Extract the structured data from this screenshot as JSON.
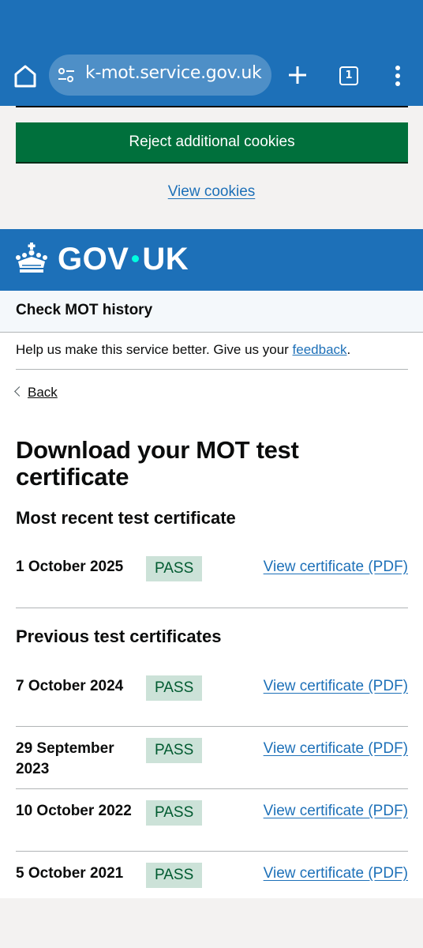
{
  "browser": {
    "url": "k-mot.service.gov.uk",
    "tab_count": "1"
  },
  "cookies": {
    "reject_label": "Reject additional cookies",
    "view_label": "View cookies"
  },
  "header": {
    "logo_left": "GOV",
    "logo_right": "UK",
    "service_name": "Check MOT history"
  },
  "feedback": {
    "prefix": "Help us make this service better. Give us your ",
    "link": "feedback",
    "suffix": "."
  },
  "back_label": "Back",
  "page_title": "Download your MOT test certificate",
  "most_recent": {
    "heading": "Most recent test certificate",
    "rows": [
      {
        "date": "1 October 2025",
        "result": "PASS",
        "link": "View certificate (PDF)"
      }
    ]
  },
  "previous": {
    "heading": "Previous test certificates",
    "rows": [
      {
        "date": "7 October 2024",
        "result": "PASS",
        "link": "View certificate (PDF)"
      },
      {
        "date": "29 September 2023",
        "result": "PASS",
        "link": "View certificate (PDF)"
      },
      {
        "date": "10 October 2022",
        "result": "PASS",
        "link": "View certificate (PDF)"
      },
      {
        "date": "5 October 2021",
        "result": "PASS",
        "link": "View certificate (PDF)"
      }
    ]
  },
  "colors": {
    "brand_blue": "#1d70b8",
    "button_green": "#00703c",
    "pass_tag_bg": "#cce2d8",
    "pass_tag_text": "#005a30"
  }
}
